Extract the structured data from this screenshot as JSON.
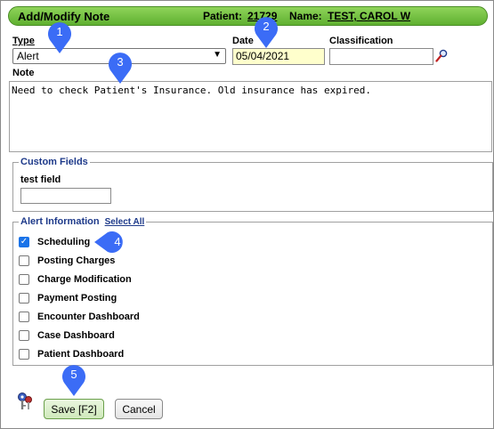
{
  "header": {
    "title": "Add/Modify Note",
    "patient_label": "Patient:",
    "patient_id": "21729",
    "name_label": "Name:",
    "patient_name": "TEST, CAROL W",
    "background_color": "#6cc040"
  },
  "form": {
    "type_label": "Type",
    "type_value": "Alert",
    "date_label": "Date",
    "date_value": "05/04/2021",
    "classification_label": "Classification",
    "classification_value": "",
    "note_label": "Note",
    "note_value": "Need to check Patient's Insurance. Old insurance has expired."
  },
  "custom_fields": {
    "legend": "Custom Fields",
    "field_label": "test field",
    "field_value": ""
  },
  "alert_information": {
    "legend": "Alert Information",
    "select_all": "Select All",
    "options": [
      {
        "label": "Scheduling",
        "checked": true
      },
      {
        "label": "Posting Charges",
        "checked": false
      },
      {
        "label": "Charge Modification",
        "checked": false
      },
      {
        "label": "Payment Posting",
        "checked": false
      },
      {
        "label": "Encounter Dashboard",
        "checked": false
      },
      {
        "label": "Case Dashboard",
        "checked": false
      },
      {
        "label": "Patient Dashboard",
        "checked": false
      }
    ]
  },
  "buttons": {
    "save": "Save [F2]",
    "cancel": "Cancel"
  },
  "callouts": [
    "1",
    "2",
    "3",
    "4",
    "5"
  ],
  "callout_color": "#3b6cf6"
}
